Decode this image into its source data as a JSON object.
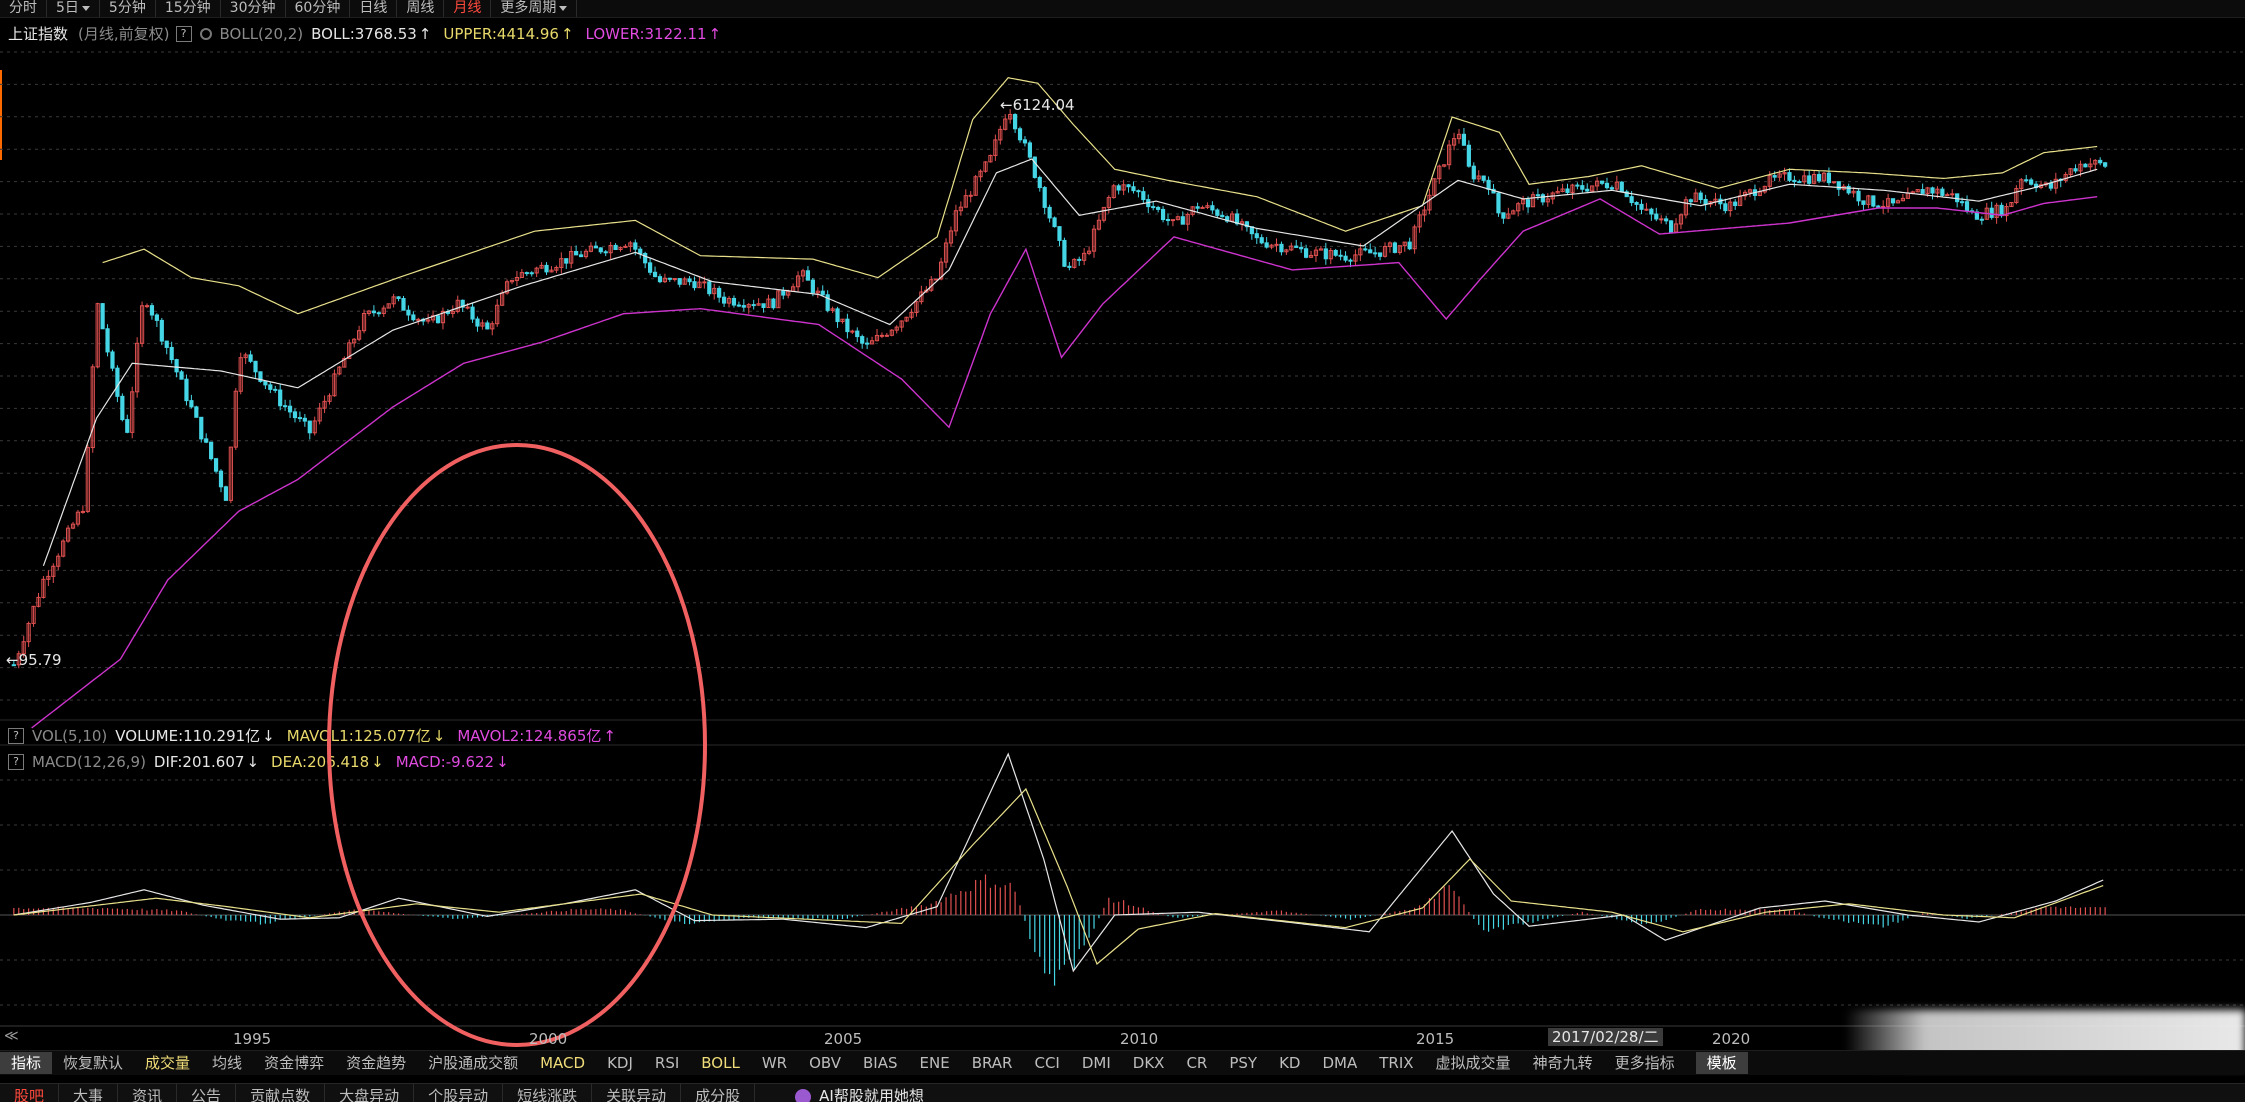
{
  "toolbar": {
    "periods": [
      {
        "label": "分时",
        "dropdown": false,
        "active": false
      },
      {
        "label": "5日",
        "dropdown": true,
        "active": false
      },
      {
        "label": "5分钟",
        "dropdown": false,
        "active": false
      },
      {
        "label": "15分钟",
        "dropdown": false,
        "active": false
      },
      {
        "label": "30分钟",
        "dropdown": false,
        "active": false
      },
      {
        "label": "60分钟",
        "dropdown": false,
        "active": false
      },
      {
        "label": "日线",
        "dropdown": false,
        "active": false
      },
      {
        "label": "周线",
        "dropdown": false,
        "active": false
      },
      {
        "label": "月线",
        "dropdown": false,
        "active": true
      },
      {
        "label": "更多周期",
        "dropdown": true,
        "active": false
      }
    ]
  },
  "main_info": {
    "symbol": "上证指数",
    "mode": "(月线,前复权)",
    "help": "?",
    "indicator": "BOLL(20,2)",
    "boll_label": "BOLL:3768.53",
    "boll_arrow": "↑",
    "upper_label": "UPPER:4414.96",
    "upper_arrow": "↑",
    "lower_label": "LOWER:3122.11",
    "lower_arrow": "↑",
    "max_marker": "←6124.04",
    "min_marker": "←95.79"
  },
  "vol_info": {
    "help": "?",
    "indicator": "VOL(5,10)",
    "volume_label": "VOLUME:110.291亿",
    "volume_arrow": "↓",
    "mavol1_label": "MAVOL1:125.077亿",
    "mavol1_arrow": "↓",
    "mavol2_label": "MAVOL2:124.865亿",
    "mavol2_arrow": "↑"
  },
  "macd_info": {
    "help": "?",
    "indicator": "MACD(12,26,9)",
    "dif_label": "DIF:201.607",
    "dif_arrow": "↓",
    "dea_label": "DEA:206.418",
    "dea_arrow": "↓",
    "macd_label": "MACD:-9.622",
    "macd_arrow": "↓"
  },
  "axis": {
    "years": [
      "1995",
      "2000",
      "2005",
      "2010",
      "2015",
      "2020"
    ],
    "cursor_date": "2017/02/28/二",
    "scroll_left": "≪"
  },
  "indicator_tabs": [
    {
      "label": "指标",
      "selected": true,
      "yellow": false
    },
    {
      "label": "恢复默认",
      "selected": false,
      "yellow": false
    },
    {
      "label": "成交量",
      "selected": false,
      "yellow": true
    },
    {
      "label": "均线",
      "selected": false,
      "yellow": false
    },
    {
      "label": "资金博弈",
      "selected": false,
      "yellow": false
    },
    {
      "label": "资金趋势",
      "selected": false,
      "yellow": false
    },
    {
      "label": "沪股通成交额",
      "selected": false,
      "yellow": false
    },
    {
      "label": "MACD",
      "selected": false,
      "yellow": true
    },
    {
      "label": "KDJ",
      "selected": false,
      "yellow": false
    },
    {
      "label": "RSI",
      "selected": false,
      "yellow": false
    },
    {
      "label": "BOLL",
      "selected": false,
      "yellow": true
    },
    {
      "label": "WR",
      "selected": false,
      "yellow": false
    },
    {
      "label": "OBV",
      "selected": false,
      "yellow": false
    },
    {
      "label": "BIAS",
      "selected": false,
      "yellow": false
    },
    {
      "label": "ENE",
      "selected": false,
      "yellow": false
    },
    {
      "label": "BRAR",
      "selected": false,
      "yellow": false
    },
    {
      "label": "CCI",
      "selected": false,
      "yellow": false
    },
    {
      "label": "DMI",
      "selected": false,
      "yellow": false
    },
    {
      "label": "DKX",
      "selected": false,
      "yellow": false
    },
    {
      "label": "CR",
      "selected": false,
      "yellow": false
    },
    {
      "label": "PSY",
      "selected": false,
      "yellow": false
    },
    {
      "label": "KD",
      "selected": false,
      "yellow": false
    },
    {
      "label": "DMA",
      "selected": false,
      "yellow": false
    },
    {
      "label": "TRIX",
      "selected": false,
      "yellow": false
    },
    {
      "label": "虚拟成交量",
      "selected": false,
      "yellow": false
    },
    {
      "label": "神奇九转",
      "selected": false,
      "yellow": false
    },
    {
      "label": "更多指标",
      "selected": false,
      "yellow": false
    },
    {
      "label": "模板",
      "selected": true,
      "yellow": false
    }
  ],
  "function_tabs": [
    {
      "label": "股吧",
      "active": true
    },
    {
      "label": "大事",
      "active": false
    },
    {
      "label": "资讯",
      "active": false
    },
    {
      "label": "公告",
      "active": false
    },
    {
      "label": "贡献点数",
      "active": false
    },
    {
      "label": "大盘异动",
      "active": false
    },
    {
      "label": "个股异动",
      "active": false
    },
    {
      "label": "短线涨跌",
      "active": false
    },
    {
      "label": "关联异动",
      "active": false
    },
    {
      "label": "成分股",
      "active": false
    }
  ],
  "ai_assistant": "AI帮股就用她想",
  "colors": {
    "up": "#e05050",
    "down": "#45d6e6",
    "boll_mid": "#e6e6e6",
    "boll_upper": "#e8e08a",
    "boll_lower": "#cc33cc",
    "annotation_circle": "#f06060",
    "active_tab": "#ff4a3d"
  },
  "chart_data": {
    "type": "candlestick",
    "series_note": "",
    "x_unit": "year",
    "y_log": true,
    "price_range": [
      95.79,
      6124.04
    ],
    "ohlc_keypoints": [
      [
        1991.0,
        96
      ],
      [
        1991.5,
        180
      ],
      [
        1992.2,
        320
      ],
      [
        1992.4,
        1430
      ],
      [
        1992.9,
        520
      ],
      [
        1993.2,
        1520
      ],
      [
        1993.6,
        1000
      ],
      [
        1994.6,
        330
      ],
      [
        1994.8,
        1000
      ],
      [
        1995.5,
        680
      ],
      [
        1996.0,
        540
      ],
      [
        1996.9,
        1250
      ],
      [
        1997.4,
        1450
      ],
      [
        1998.0,
        1200
      ],
      [
        1998.5,
        1400
      ],
      [
        1999.0,
        1150
      ],
      [
        1999.4,
        1700
      ],
      [
        2000.5,
        2000
      ],
      [
        2001.4,
        2240
      ],
      [
        2001.9,
        1650
      ],
      [
        2002.5,
        1650
      ],
      [
        2003.0,
        1450
      ],
      [
        2003.8,
        1400
      ],
      [
        2004.3,
        1750
      ],
      [
        2005.0,
        1200
      ],
      [
        2005.4,
        1010
      ],
      [
        2006.0,
        1250
      ],
      [
        2006.6,
        1700
      ],
      [
        2006.9,
        2700
      ],
      [
        2007.5,
        4100
      ],
      [
        2007.8,
        6124
      ],
      [
        2008.3,
        3500
      ],
      [
        2008.8,
        1800
      ],
      [
        2009.1,
        2000
      ],
      [
        2009.6,
        3400
      ],
      [
        2010.0,
        3200
      ],
      [
        2010.6,
        2500
      ],
      [
        2011.0,
        2900
      ],
      [
        2011.5,
        2700
      ],
      [
        2012.0,
        2250
      ],
      [
        2012.9,
        2050
      ],
      [
        2013.5,
        2000
      ],
      [
        2014.0,
        2050
      ],
      [
        2014.6,
        2200
      ],
      [
        2014.9,
        3100
      ],
      [
        2015.4,
        5178
      ],
      [
        2015.6,
        3700
      ],
      [
        2015.9,
        3500
      ],
      [
        2016.1,
        2700
      ],
      [
        2016.5,
        2950
      ],
      [
        2017.0,
        3150
      ],
      [
        2017.6,
        3350
      ],
      [
        2018.1,
        3450
      ],
      [
        2018.5,
        2800
      ],
      [
        2019.0,
        2480
      ],
      [
        2019.3,
        3100
      ],
      [
        2020.0,
        2900
      ],
      [
        2020.6,
        3450
      ],
      [
        2021.0,
        3600
      ],
      [
        2021.7,
        3550
      ],
      [
        2022.3,
        3000
      ],
      [
        2022.8,
        2900
      ],
      [
        2023.3,
        3300
      ],
      [
        2023.8,
        3100
      ],
      [
        2024.1,
        2700
      ],
      [
        2024.7,
        2850
      ],
      [
        2024.9,
        3600
      ],
      [
        2025.4,
        3300
      ],
      [
        2025.8,
        3850
      ],
      [
        2026.0,
        4000
      ],
      [
        2026.4,
        3900
      ]
    ],
    "boll_upper_keypoints": [
      [
        1992.5,
        1900
      ],
      [
        1993.2,
        2100
      ],
      [
        1994.0,
        1700
      ],
      [
        1994.8,
        1600
      ],
      [
        1995.8,
        1300
      ],
      [
        1997.5,
        1700
      ],
      [
        1999.8,
        2400
      ],
      [
        2001.5,
        2600
      ],
      [
        2002.6,
        2000
      ],
      [
        2004.5,
        1950
      ],
      [
        2005.6,
        1700
      ],
      [
        2006.6,
        2300
      ],
      [
        2007.2,
        5500
      ],
      [
        2007.8,
        7500
      ],
      [
        2008.3,
        7200
      ],
      [
        2008.9,
        5300
      ],
      [
        2009.6,
        3800
      ],
      [
        2010.5,
        3500
      ],
      [
        2012.0,
        3100
      ],
      [
        2013.5,
        2400
      ],
      [
        2014.8,
        2900
      ],
      [
        2015.3,
        5600
      ],
      [
        2016.1,
        5000
      ],
      [
        2016.6,
        3400
      ],
      [
        2017.6,
        3600
      ],
      [
        2018.5,
        3900
      ],
      [
        2019.8,
        3300
      ],
      [
        2021.0,
        3800
      ],
      [
        2022.3,
        3700
      ],
      [
        2023.6,
        3550
      ],
      [
        2024.6,
        3700
      ],
      [
        2025.3,
        4300
      ],
      [
        2026.2,
        4500
      ]
    ],
    "boll_mid_keypoints": [
      [
        1991.5,
        200
      ],
      [
        1992.4,
        600
      ],
      [
        1993.0,
        900
      ],
      [
        1994.5,
        850
      ],
      [
        1995.8,
        750
      ],
      [
        1997.4,
        1150
      ],
      [
        1999.6,
        1600
      ],
      [
        2001.5,
        2050
      ],
      [
        2002.8,
        1650
      ],
      [
        2004.6,
        1500
      ],
      [
        2005.8,
        1200
      ],
      [
        2006.8,
        1800
      ],
      [
        2007.6,
        3700
      ],
      [
        2008.2,
        4100
      ],
      [
        2009.0,
        2700
      ],
      [
        2010.3,
        3000
      ],
      [
        2012.0,
        2450
      ],
      [
        2013.8,
        2150
      ],
      [
        2015.4,
        3500
      ],
      [
        2016.5,
        3050
      ],
      [
        2018.0,
        3250
      ],
      [
        2019.5,
        2900
      ],
      [
        2021.0,
        3400
      ],
      [
        2022.6,
        3250
      ],
      [
        2024.2,
        3000
      ],
      [
        2025.1,
        3300
      ],
      [
        2026.2,
        3800
      ]
    ],
    "boll_lower_keypoints": [
      [
        1991.3,
        60
      ],
      [
        1992.8,
        100
      ],
      [
        1993.6,
        180
      ],
      [
        1994.8,
        300
      ],
      [
        1995.8,
        380
      ],
      [
        1997.4,
        650
      ],
      [
        1998.6,
        900
      ],
      [
        1999.9,
        1050
      ],
      [
        2001.3,
        1300
      ],
      [
        2002.6,
        1350
      ],
      [
        2004.6,
        1200
      ],
      [
        2006.0,
        800
      ],
      [
        2006.8,
        560
      ],
      [
        2007.5,
        1300
      ],
      [
        2008.1,
        2100
      ],
      [
        2008.7,
        940
      ],
      [
        2009.4,
        1400
      ],
      [
        2010.6,
        2300
      ],
      [
        2012.6,
        1800
      ],
      [
        2014.4,
        1900
      ],
      [
        2015.2,
        1250
      ],
      [
        2015.8,
        1700
      ],
      [
        2016.5,
        2400
      ],
      [
        2017.8,
        3050
      ],
      [
        2018.8,
        2350
      ],
      [
        2021.0,
        2550
      ],
      [
        2022.5,
        2850
      ],
      [
        2023.5,
        2850
      ],
      [
        2024.6,
        2700
      ],
      [
        2025.3,
        2950
      ],
      [
        2026.2,
        3100
      ]
    ],
    "macd_dif_keypoints": [
      [
        1991.0,
        0
      ],
      [
        1992.3,
        90
      ],
      [
        1993.2,
        180
      ],
      [
        1994.2,
        70
      ],
      [
        1995.5,
        -30
      ],
      [
        1996.5,
        -20
      ],
      [
        1997.5,
        120
      ],
      [
        1999.0,
        -10
      ],
      [
        2000.3,
        80
      ],
      [
        2001.5,
        180
      ],
      [
        2002.5,
        -40
      ],
      [
        2004.0,
        -30
      ],
      [
        2005.4,
        -90
      ],
      [
        2006.6,
        60
      ],
      [
        2007.8,
        1150
      ],
      [
        2008.4,
        400
      ],
      [
        2008.9,
        -400
      ],
      [
        2009.6,
        0
      ],
      [
        2011.0,
        20
      ],
      [
        2012.5,
        -50
      ],
      [
        2013.9,
        -120
      ],
      [
        2015.3,
        600
      ],
      [
        2016.0,
        150
      ],
      [
        2016.6,
        -80
      ],
      [
        2018.2,
        0
      ],
      [
        2018.9,
        -180
      ],
      [
        2020.5,
        50
      ],
      [
        2021.6,
        100
      ],
      [
        2023.0,
        0
      ],
      [
        2024.2,
        -50
      ],
      [
        2025.5,
        100
      ],
      [
        2026.3,
        250
      ]
    ],
    "macd_dea_keypoints": [
      [
        1991.0,
        0
      ],
      [
        1993.4,
        120
      ],
      [
        1994.6,
        60
      ],
      [
        1996.0,
        -20
      ],
      [
        1997.8,
        80
      ],
      [
        1999.2,
        20
      ],
      [
        2001.6,
        150
      ],
      [
        2002.8,
        0
      ],
      [
        2004.4,
        -30
      ],
      [
        2006.0,
        -60
      ],
      [
        2007.2,
        500
      ],
      [
        2008.1,
        900
      ],
      [
        2008.8,
        200
      ],
      [
        2009.3,
        -350
      ],
      [
        2010.0,
        -100
      ],
      [
        2011.3,
        10
      ],
      [
        2013.5,
        -90
      ],
      [
        2014.8,
        50
      ],
      [
        2015.6,
        400
      ],
      [
        2016.3,
        100
      ],
      [
        2018.0,
        20
      ],
      [
        2019.2,
        -120
      ],
      [
        2020.6,
        20
      ],
      [
        2022.0,
        80
      ],
      [
        2023.6,
        0
      ],
      [
        2024.8,
        -20
      ],
      [
        2026.3,
        210
      ]
    ],
    "macd_hist_keypoints": [
      [
        1992.5,
        50
      ],
      [
        1993.8,
        30
      ],
      [
        1994.6,
        -40
      ],
      [
        1995.2,
        -60
      ],
      [
        1996.8,
        40
      ],
      [
        1998.5,
        -30
      ],
      [
        2000.5,
        40
      ],
      [
        2001.2,
        40
      ],
      [
        2002.3,
        -60
      ],
      [
        2003.5,
        -20
      ],
      [
        2005.0,
        -30
      ],
      [
        2006.5,
        80
      ],
      [
        2007.4,
        250
      ],
      [
        2007.9,
        200
      ],
      [
        2008.2,
        -200
      ],
      [
        2008.6,
        -500
      ],
      [
        2009.0,
        -300
      ],
      [
        2009.5,
        120
      ],
      [
        2010.6,
        -20
      ],
      [
        2012.4,
        30
      ],
      [
        2013.6,
        -30
      ],
      [
        2014.6,
        40
      ],
      [
        2015.3,
        200
      ],
      [
        2015.8,
        -120
      ],
      [
        2016.4,
        -70
      ],
      [
        2017.5,
        20
      ],
      [
        2018.6,
        -70
      ],
      [
        2019.5,
        40
      ],
      [
        2021.0,
        40
      ],
      [
        2021.5,
        -20
      ],
      [
        2022.6,
        -80
      ],
      [
        2023.3,
        20
      ],
      [
        2024.0,
        -30
      ],
      [
        2025.4,
        60
      ],
      [
        2026.0,
        50
      ]
    ]
  }
}
